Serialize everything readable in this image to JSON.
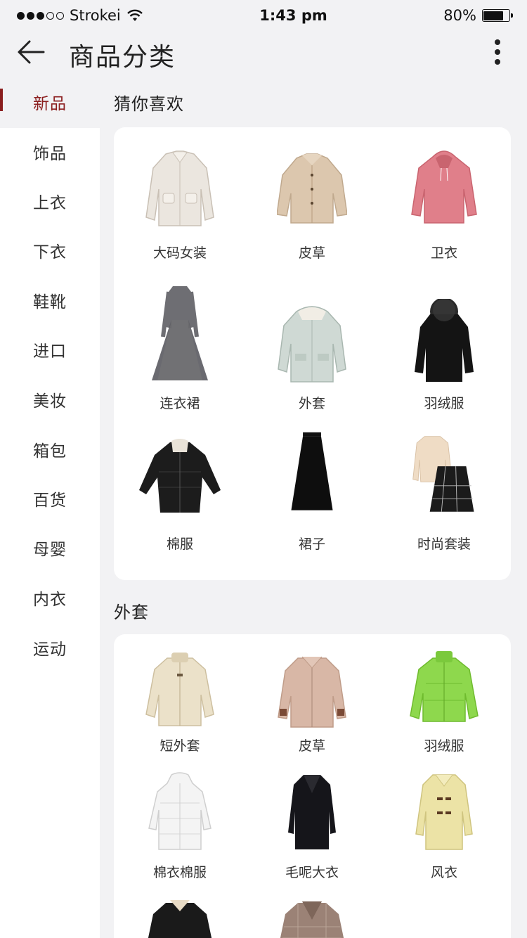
{
  "status": {
    "carrier": "Strokei",
    "time": "1:43 pm",
    "battery": "80%",
    "battery_level": 0.8
  },
  "nav": {
    "title": "商品分类"
  },
  "sidebar": {
    "items": [
      {
        "label": "新品",
        "active": true
      },
      {
        "label": "饰品"
      },
      {
        "label": "上衣"
      },
      {
        "label": "下衣"
      },
      {
        "label": "鞋靴"
      },
      {
        "label": "进口"
      },
      {
        "label": "美妆"
      },
      {
        "label": "箱包"
      },
      {
        "label": "百货"
      },
      {
        "label": "母婴"
      },
      {
        "label": "内衣"
      },
      {
        "label": "运动"
      }
    ]
  },
  "sections": [
    {
      "title": "猜你喜欢",
      "items": [
        {
          "label": "大码女装",
          "icon": "cream-coat-image"
        },
        {
          "label": "皮草",
          "icon": "beige-fur-jacket-image"
        },
        {
          "label": "卫衣",
          "icon": "pink-hoodie-image"
        },
        {
          "label": "连衣裙",
          "icon": "grey-dress-image"
        },
        {
          "label": "外套",
          "icon": "mint-parka-image"
        },
        {
          "label": "羽绒服",
          "icon": "black-down-coat-image"
        },
        {
          "label": "棉服",
          "icon": "black-puffer-image"
        },
        {
          "label": "裙子",
          "icon": "black-skirt-image"
        },
        {
          "label": "时尚套装",
          "icon": "sweater-skirt-set-image"
        }
      ]
    },
    {
      "title": "外套",
      "items": [
        {
          "label": "短外套",
          "icon": "cream-short-jacket-image"
        },
        {
          "label": "皮草",
          "icon": "pink-fur-coat-image"
        },
        {
          "label": "羽绒服",
          "icon": "green-down-jacket-image"
        },
        {
          "label": "棉衣棉服",
          "icon": "white-long-puffer-image"
        },
        {
          "label": "毛呢大衣",
          "icon": "black-wool-coat-image"
        },
        {
          "label": "风衣",
          "icon": "beige-trench-image"
        },
        {
          "label": "",
          "icon": "leather-jacket-image"
        },
        {
          "label": "",
          "icon": "plaid-blazer-image"
        }
      ]
    }
  ]
}
